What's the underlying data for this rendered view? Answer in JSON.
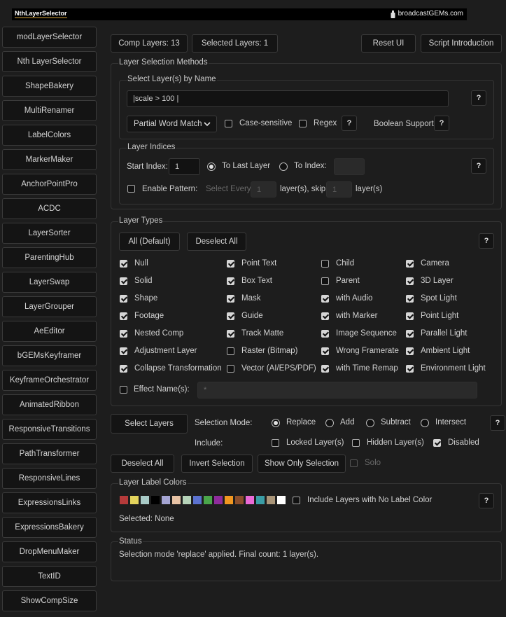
{
  "header": {
    "brand_left": "NthLayerSelector",
    "brand_right": "broadcastGEMs.com",
    "brand_right_icon": "bottle-icon"
  },
  "sidebar": [
    "modLayerSelector",
    "Nth LayerSelector",
    "ShapeBakery",
    "MultiRenamer",
    "LabelColors",
    "MarkerMaker",
    "AnchorPointPro",
    "ACDC",
    "LayerSorter",
    "ParentingHub",
    "LayerSwap",
    "LayerGrouper",
    "AeEditor",
    "bGEMsKeyframer",
    "KeyframeOrchestrator",
    "AnimatedRibbon",
    "ResponsiveTransitions",
    "PathTransformer",
    "ResponsiveLines",
    "ExpressionsLinks",
    "ExpressionsBakery",
    "DropMenuMaker",
    "TextID",
    "ShowCompSize"
  ],
  "toolbar": {
    "comp_layers": "Comp Layers: 13",
    "selected_layers": "Selected Layers: 1",
    "reset": "Reset UI",
    "intro": "Script Introduction"
  },
  "methods": {
    "title": "Layer Selection Methods",
    "by_name": {
      "title": "Select Layer(s) by Name",
      "value": "|scale > 100 |",
      "match_mode": "Partial Word Match",
      "case": "Case-sensitive",
      "regex": "Regex",
      "boolean": "Boolean Support",
      "help": "?"
    },
    "indices": {
      "title": "Layer Indices",
      "start_label": "Start Index:",
      "start_value": "1",
      "to_last": "To Last Layer",
      "to_index": "To Index:",
      "pattern": "Enable Pattern:",
      "select_every": "Select Every",
      "every_value": "1",
      "skip_label": "layer(s), skip",
      "skip_value": "1",
      "tail": "layer(s)"
    }
  },
  "types": {
    "title": "Layer Types",
    "all": "All (Default)",
    "deselect": "Deselect All",
    "columns": [
      [
        {
          "l": "Null",
          "c": true
        },
        {
          "l": "Solid",
          "c": true
        },
        {
          "l": "Shape",
          "c": true
        },
        {
          "l": "Footage",
          "c": true
        },
        {
          "l": "Nested Comp",
          "c": true
        },
        {
          "l": "Adjustment Layer",
          "c": true
        },
        {
          "l": "Collapse Transformation",
          "c": true
        }
      ],
      [
        {
          "l": "Point Text",
          "c": true
        },
        {
          "l": "Box Text",
          "c": true
        },
        {
          "l": "Mask",
          "c": true
        },
        {
          "l": "Guide",
          "c": true
        },
        {
          "l": "Track Matte",
          "c": true
        },
        {
          "l": "Raster (Bitmap)",
          "c": false
        },
        {
          "l": "Vector (AI/EPS/PDF)",
          "c": false
        }
      ],
      [
        {
          "l": "Child",
          "c": false
        },
        {
          "l": "Parent",
          "c": false
        },
        {
          "l": "with Audio",
          "c": true
        },
        {
          "l": "with Marker",
          "c": true
        },
        {
          "l": "Image Sequence",
          "c": true
        },
        {
          "l": "Wrong Framerate",
          "c": true
        },
        {
          "l": "with Time Remap",
          "c": true
        }
      ],
      [
        {
          "l": "Camera",
          "c": true
        },
        {
          "l": "3D Layer",
          "c": true
        },
        {
          "l": "Spot Light",
          "c": true
        },
        {
          "l": "Point Light",
          "c": true
        },
        {
          "l": "Parallel Light",
          "c": true
        },
        {
          "l": "Ambient Light",
          "c": true
        },
        {
          "l": "Environment Light",
          "c": true
        }
      ]
    ],
    "effect_label": "Effect Name(s):",
    "effect_placeholder": "*"
  },
  "selection": {
    "select_btn": "Select Layers",
    "mode_label": "Selection Mode:",
    "modes": [
      "Replace",
      "Add",
      "Subtract",
      "Intersect"
    ],
    "mode_selected": "Replace",
    "include_label": "Include:",
    "locked": "Locked Layer(s)",
    "hidden": "Hidden Layer(s)",
    "disabled": "Disabled",
    "deselect": "Deselect All",
    "invert": "Invert Selection",
    "only": "Show Only Selection",
    "solo": "Solo"
  },
  "label_colors": {
    "title": "Layer Label Colors",
    "swatches": [
      "#b53a3a",
      "#e3d35c",
      "#a9cbc7",
      "#000000",
      "#a5a5d3",
      "#e7c2a4",
      "#b5d2b8",
      "#5b72cf",
      "#4aa54a",
      "#8e2c9c",
      "#f19720",
      "#8a4e2c",
      "#ea6ad6",
      "#3a9da5",
      "#a99578",
      "#ffffff"
    ],
    "include_none": "Include Layers with No Label Color",
    "selected": "Selected: None"
  },
  "status": {
    "title": "Status",
    "text": "Selection mode 'replace' applied. Final count: 1 layer(s)."
  }
}
